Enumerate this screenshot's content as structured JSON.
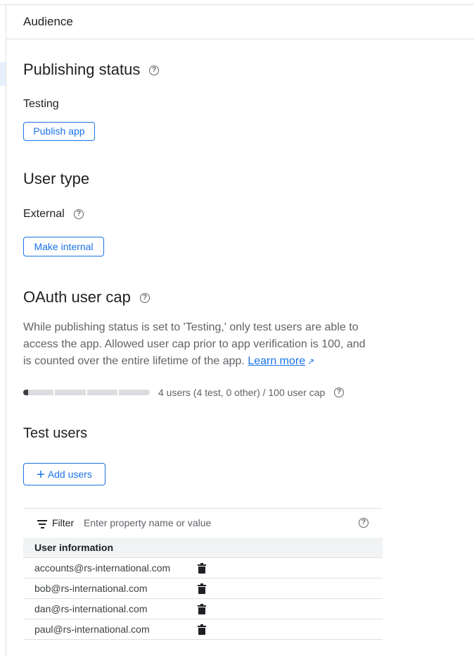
{
  "header": {
    "title": "Audience"
  },
  "publishing": {
    "heading": "Publishing status",
    "status": "Testing",
    "publish_button": "Publish app"
  },
  "user_type": {
    "heading": "User type",
    "value": "External",
    "make_internal_button": "Make internal"
  },
  "oauth_cap": {
    "heading": "OAuth user cap",
    "description": "While publishing status is set to 'Testing,' only test users are able to access the app. Allowed user cap prior to app verification is 100, and is counted over the entire lifetime of the app.",
    "learn_more": "Learn more",
    "usage_fraction": 0.04,
    "usage_text": "4 users (4 test, 0 other) / 100 user cap"
  },
  "test_users": {
    "heading": "Test users",
    "add_button": "Add users",
    "filter_label": "Filter",
    "filter_placeholder": "Enter property name or value",
    "column_header": "User information",
    "rows": [
      {
        "email": "accounts@rs-international.com"
      },
      {
        "email": "bob@rs-international.com"
      },
      {
        "email": "dan@rs-international.com"
      },
      {
        "email": "paul@rs-international.com"
      }
    ]
  },
  "icons": {
    "help": "help-circle-icon",
    "external_link": "external-link-icon",
    "filter": "filter-icon",
    "add": "plus-icon",
    "delete": "trash-icon"
  },
  "colors": {
    "accent": "#1a73e8",
    "text": "#202124",
    "muted": "#5f6368"
  }
}
